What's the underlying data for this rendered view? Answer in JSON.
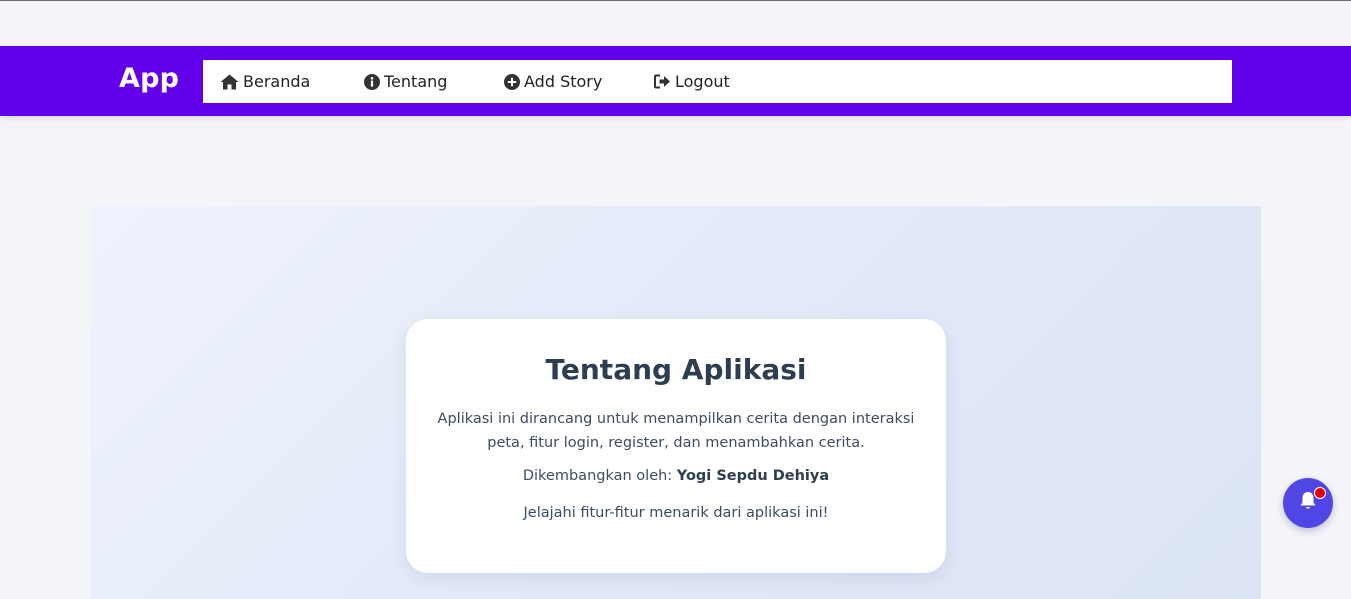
{
  "navbar": {
    "brand": "App",
    "items": [
      {
        "label": "Beranda",
        "icon": "home-icon"
      },
      {
        "label": "Tentang",
        "icon": "info-icon"
      },
      {
        "label": "Add Story",
        "icon": "plus-circle-icon"
      },
      {
        "label": "Logout",
        "icon": "logout-icon"
      }
    ]
  },
  "about": {
    "title": "Tentang Aplikasi",
    "description": "Aplikasi ini dirancang untuk menampilkan cerita dengan interaksi peta, fitur login, register, dan menambahkan cerita.",
    "developer_prefix": "Dikembangkan oleh:",
    "developer_name": "Yogi Sepdu Dehiya",
    "tagline": "Jelajahi fitur-fitur menarik dari aplikasi ini!"
  },
  "notification": {
    "icon": "bell-icon",
    "has_unread": true
  },
  "colors": {
    "navbar": "#6200ea",
    "bell_button": "#4f46e5",
    "badge": "#e00000",
    "title_text": "#2c3e50"
  }
}
